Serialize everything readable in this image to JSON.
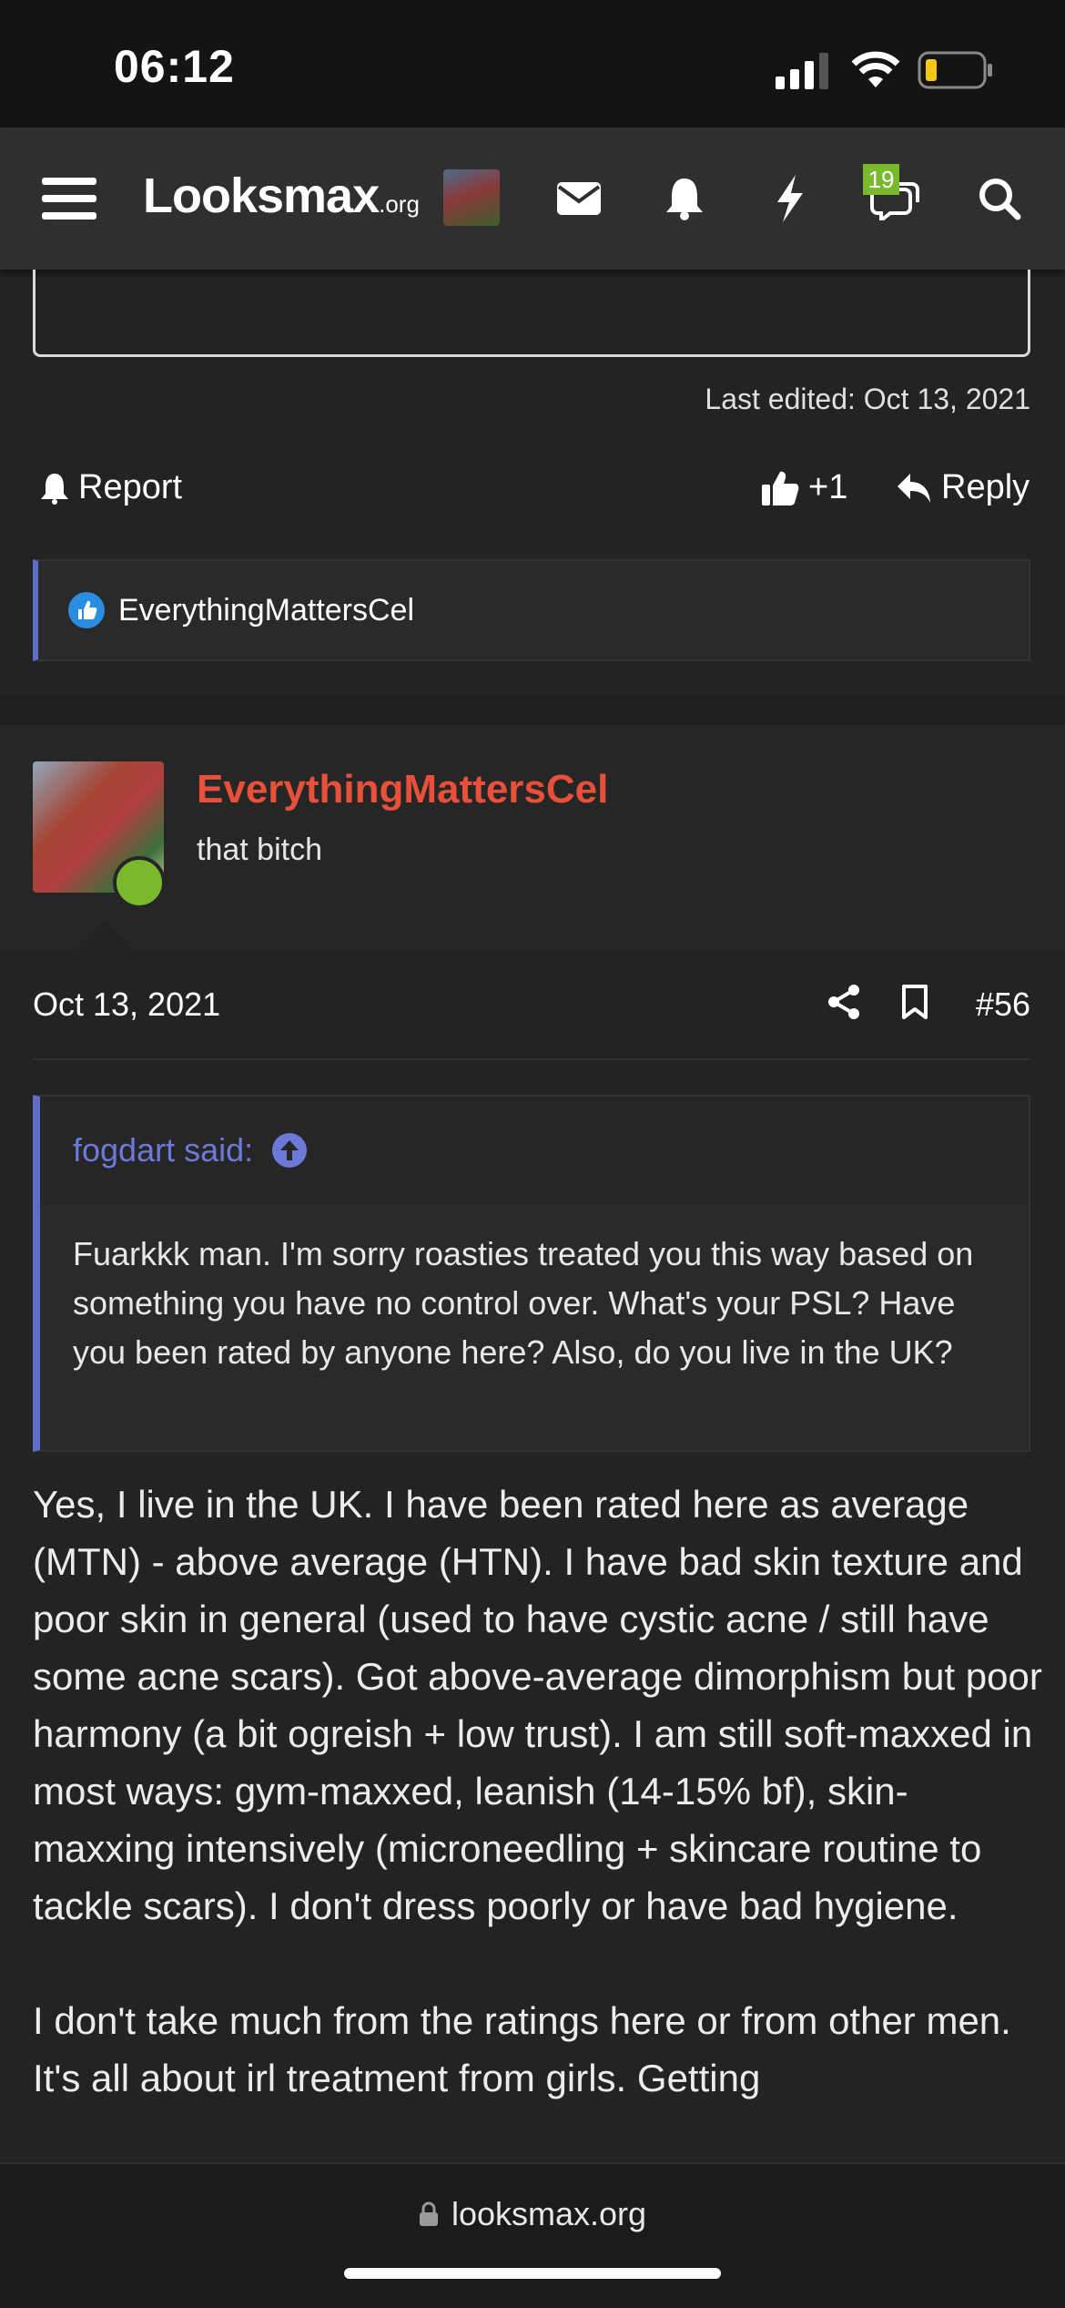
{
  "status_bar": {
    "time": "06:12"
  },
  "nav": {
    "logo": "Looksmax",
    "logo_suffix": ".org",
    "messages_badge": "19"
  },
  "previous_post": {
    "last_edited": "Last edited: Oct 13, 2021",
    "report_label": "Report",
    "like_count": "+1",
    "reply_label": "Reply",
    "reaction_user": "EverythingMattersCel"
  },
  "post": {
    "author": "EverythingMattersCel",
    "author_title": "that bitch",
    "date": "Oct 13, 2021",
    "number": "#56",
    "quote_author": "fogdart said:",
    "quote_text": "Fuarkkk man. I'm sorry roasties treated you this way based on something you have no control over. What's your PSL? Have you been rated by anyone here? Also, do you live in the UK?",
    "paragraph1": "Yes, I live in the UK. I have been rated here as average (MTN) - above average (HTN). I have bad skin texture and poor skin in general (used to have cystic acne / still have some acne scars). Got above-average dimorphism but poor harmony (a bit ogreish + low trust). I am still soft-maxxed in most ways: gym-maxxed, leanish (14-15% bf), skin-maxxing intensively (microneedling + skincare routine to tackle scars). I don't dress poorly or have bad hygiene.",
    "paragraph2": "I don't take much from the ratings here or from other men. It's all about irl treatment from girls. Getting"
  },
  "browser": {
    "url": "looksmax.org"
  },
  "colors": {
    "accent": "#5f6cc9",
    "username": "#e8503a",
    "online": "#7ab82e",
    "badge": "#7ab82e"
  }
}
